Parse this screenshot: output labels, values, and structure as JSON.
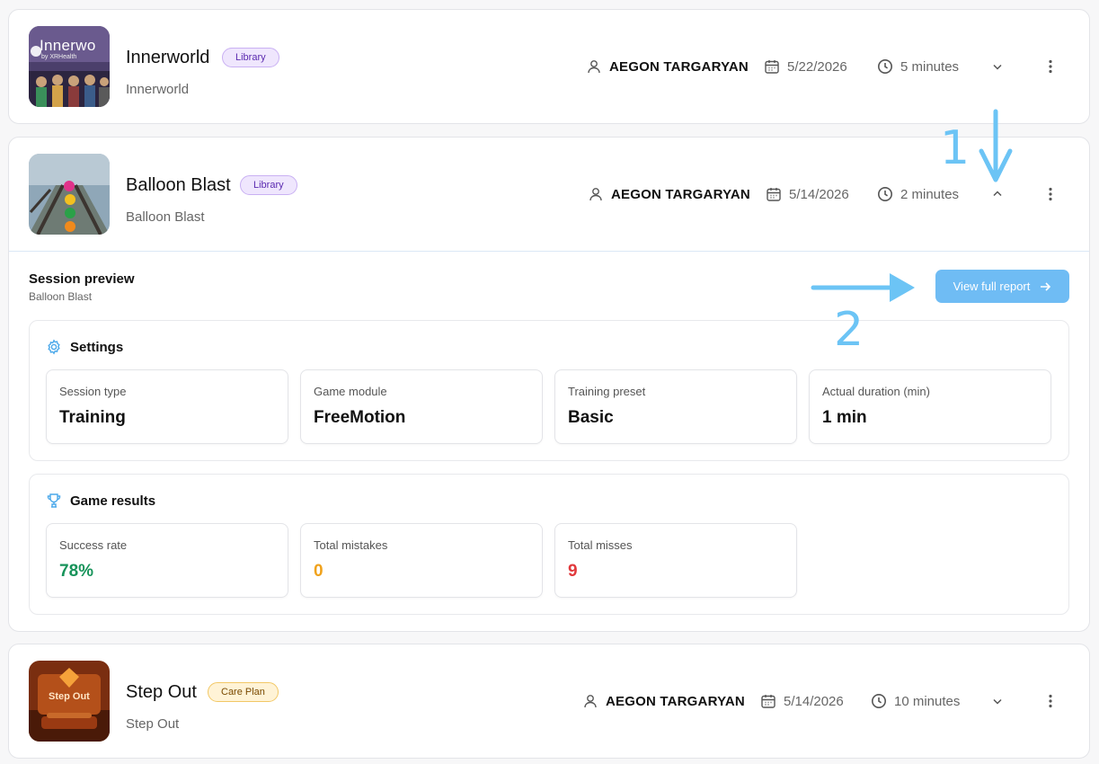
{
  "sessions": [
    {
      "title": "Innerworld",
      "badge": "Library",
      "subtitle": "Innerworld",
      "user": "AEGON TARGARYAN",
      "date": "5/22/2026",
      "duration": "5 minutes",
      "thumb_text": "Innerwo",
      "thumb_subtext": "by XRHealth"
    },
    {
      "title": "Balloon Blast",
      "badge": "Library",
      "subtitle": "Balloon Blast",
      "user": "AEGON TARGARYAN",
      "date": "5/14/2026",
      "duration": "2 minutes"
    },
    {
      "title": "Step Out",
      "badge": "Care Plan",
      "subtitle": "Step Out",
      "user": "AEGON TARGARYAN",
      "date": "5/14/2026",
      "duration": "10 minutes",
      "thumb_text": "Step Out"
    }
  ],
  "preview": {
    "title": "Session preview",
    "subtitle": "Balloon Blast",
    "report_button": "View full report",
    "settings": {
      "heading": "Settings",
      "tiles": [
        {
          "label": "Session type",
          "value": "Training"
        },
        {
          "label": "Game module",
          "value": "FreeMotion"
        },
        {
          "label": "Training preset",
          "value": "Basic"
        },
        {
          "label": "Actual duration (min)",
          "value": "1 min"
        }
      ]
    },
    "results": {
      "heading": "Game results",
      "tiles": [
        {
          "label": "Success rate",
          "value": "78%"
        },
        {
          "label": "Total mistakes",
          "value": "0"
        },
        {
          "label": "Total misses",
          "value": "9"
        }
      ]
    }
  },
  "annotations": {
    "one": "1",
    "two": "2"
  },
  "colors": {
    "accent": "#6fbcf4",
    "library_badge": "#efe6fd",
    "careplan_badge": "#fff3d6",
    "success": "#17935a",
    "warning": "#f0a21c",
    "danger": "#e1393c"
  }
}
